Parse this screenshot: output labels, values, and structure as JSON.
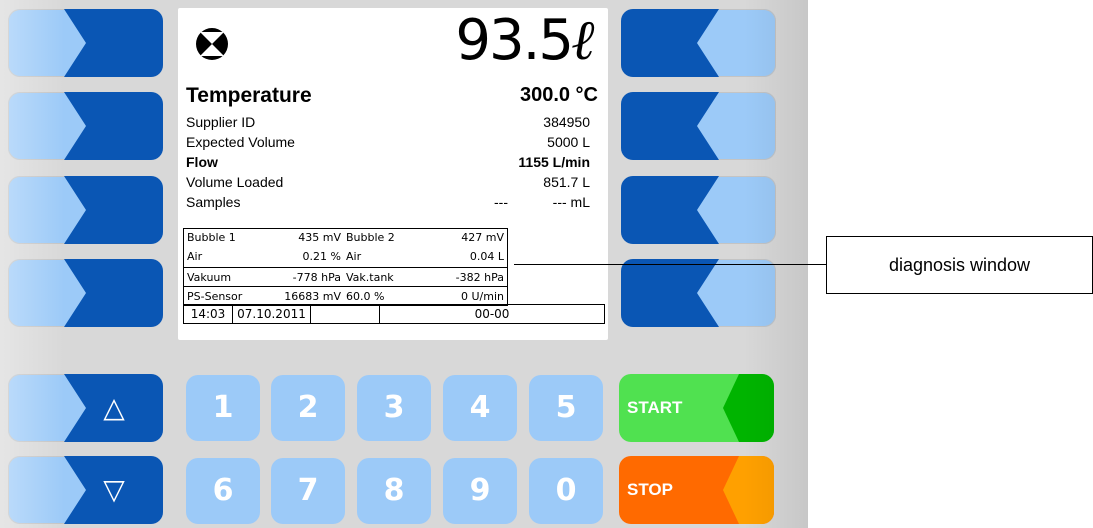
{
  "display": {
    "volume_value": "93.5",
    "volume_unit": "ℓ",
    "title": "Temperature",
    "temperature": "300.0 °C",
    "rows": [
      {
        "label": "Supplier ID",
        "value": "384950"
      },
      {
        "label": "Expected Volume",
        "value": "5000 L"
      },
      {
        "label": "Flow",
        "value": "1155 L/min"
      },
      {
        "label": "Volume Loaded",
        "value": "851.7 L"
      },
      {
        "label": "Samples",
        "mid": "---",
        "value": "--- mL"
      }
    ],
    "diagnosis": [
      {
        "l1": "Bubble 1",
        "v1": "435 mV",
        "l2": "Bubble 2",
        "v2": "427 mV"
      },
      {
        "l1": "Air",
        "v1": "0.21 %",
        "l2": "Air",
        "v2": "0.04 L"
      },
      {
        "l1": "Vakuum",
        "v1": "-778 hPa",
        "l2": "Vak.tank",
        "v2": "-382 hPa"
      },
      {
        "l1": "PS-Sensor",
        "v1": "16683 mV",
        "l2": "60.0 %",
        "v2": "0 U/min"
      }
    ],
    "status": {
      "time": "14:03",
      "date": "07.10.2011",
      "code": "00-00"
    }
  },
  "keys": {
    "up_glyph": "△",
    "down_glyph": "▽",
    "digits_row1": [
      "1",
      "2",
      "3",
      "4",
      "5"
    ],
    "digits_row2": [
      "6",
      "7",
      "8",
      "9",
      "0"
    ],
    "start_label": "START",
    "stop_label": "STOP"
  },
  "callout": {
    "label": "diagnosis window"
  },
  "colors": {
    "key_light": "#9ccaf8",
    "key_dark": "#0a56b4",
    "start_light": "#50e150",
    "start_dark": "#00b400",
    "stop_light": "#ff6a00",
    "stop_dark": "#ffa000",
    "panel": "#d8d8d8"
  },
  "icons": {
    "status_icon": "circle-x-icon"
  }
}
